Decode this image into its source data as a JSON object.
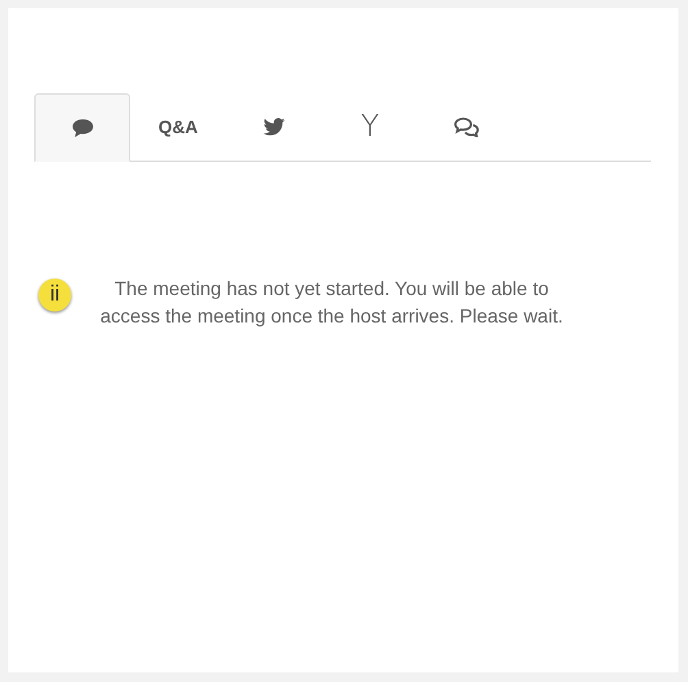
{
  "tabs": [
    {
      "kind": "chat",
      "selected": true
    },
    {
      "kind": "text",
      "label": "Q&A",
      "selected": false
    },
    {
      "kind": "bird",
      "selected": false
    },
    {
      "kind": "letter",
      "label": "Y",
      "selected": false
    },
    {
      "kind": "comments",
      "selected": false
    }
  ],
  "notice": {
    "badge": "ii",
    "message": "The meeting has not yet started. You will be able to access the meeting once the host arrives. Please wait."
  }
}
